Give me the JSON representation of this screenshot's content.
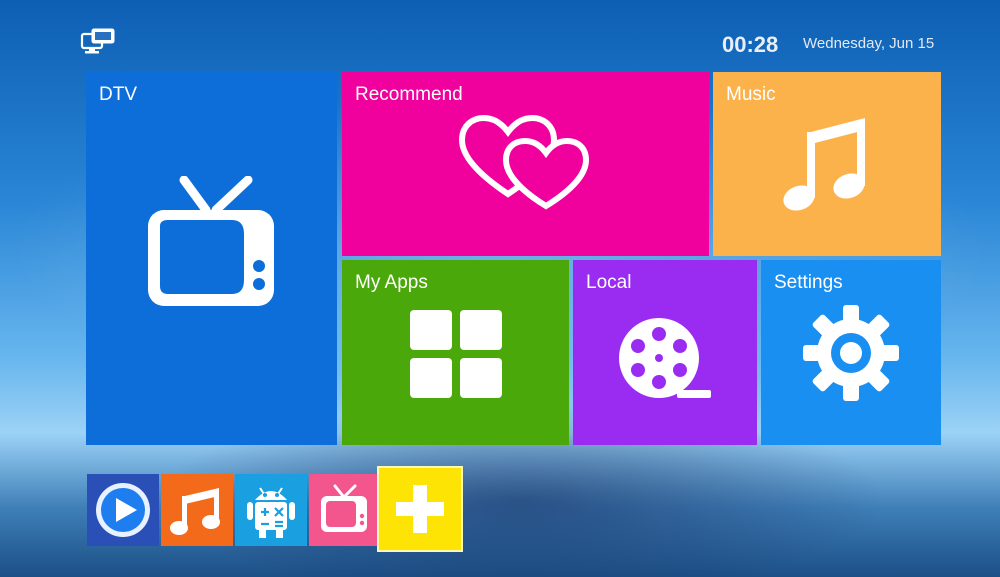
{
  "status_bar": {
    "network_icon": "network-icon",
    "time": "00:28",
    "date": "Wednesday, Jun 15"
  },
  "tiles": {
    "dtv": {
      "label": "DTV",
      "icon": "tv-icon",
      "color": "#0d6dd9"
    },
    "recommend": {
      "label": "Recommend",
      "icon": "hearts-icon",
      "color": "#f0009c"
    },
    "music": {
      "label": "Music",
      "icon": "music-note-icon",
      "color": "#fcb24b"
    },
    "my_apps": {
      "label": "My Apps",
      "icon": "grid-icon",
      "color": "#4ba80a"
    },
    "local": {
      "label": "Local",
      "icon": "film-reel-icon",
      "color": "#9a2cf2"
    },
    "settings": {
      "label": "Settings",
      "icon": "gear-icon",
      "color": "#198ff2"
    }
  },
  "dock": [
    {
      "icon": "video-player-icon",
      "color": "#2a4fb7"
    },
    {
      "icon": "music-app-icon",
      "color": "#f46a1b"
    },
    {
      "icon": "android-calculator-icon",
      "color": "#1aa0e0"
    },
    {
      "icon": "tv-app-icon",
      "color": "#f3568c"
    },
    {
      "icon": "add-icon",
      "color": "#fde405"
    }
  ]
}
